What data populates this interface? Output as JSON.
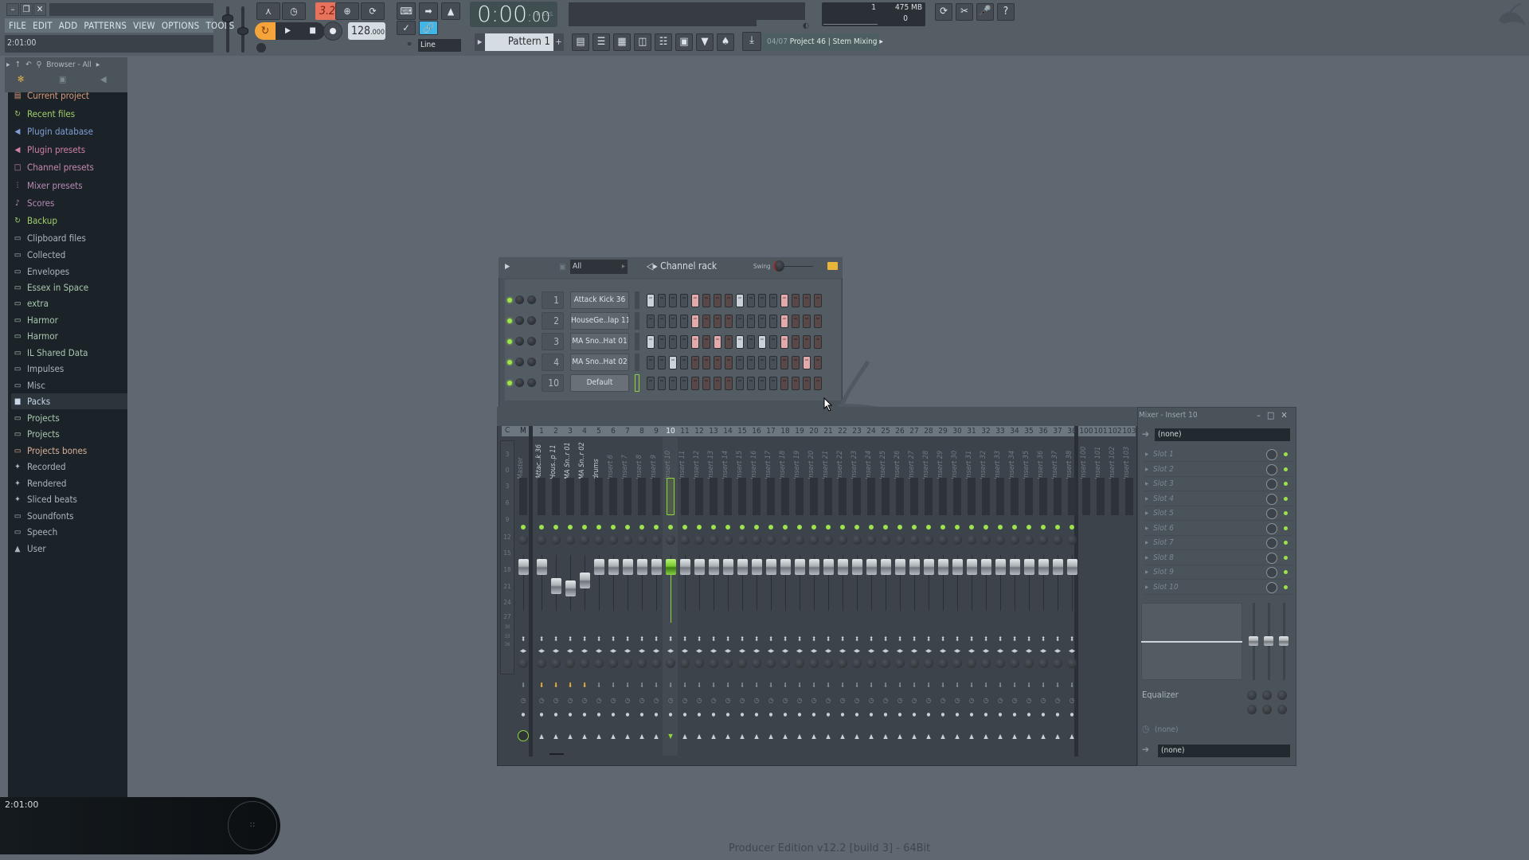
{
  "window": {
    "title": "",
    "controls": [
      "minimize",
      "restore",
      "close"
    ]
  },
  "menu": [
    "FILE",
    "EDIT",
    "ADD",
    "PATTERNS",
    "VIEW",
    "OPTIONS",
    "TOOLS",
    "?"
  ],
  "hint_bar": {
    "text": "2:01:00"
  },
  "toolbar": {
    "pattern_mode_label": "3.2",
    "tempo": "128",
    "tempo_decimals": ".000",
    "time": "0:00",
    "time_cs": ":00",
    "time_format": "M:S:CS",
    "snap_label": "Line",
    "pattern_name": "Pattern 1",
    "pattern_add": "+",
    "cpu_value": "1",
    "memory": "475 MB",
    "polyphony": "0",
    "song_info": {
      "index": "04/07",
      "name": "Project 46 | Stem Mixing"
    }
  },
  "browser": {
    "title": "Browser - All",
    "items": [
      {
        "label": "Current project",
        "icon": "project-icon",
        "color": "#d99a7a"
      },
      {
        "label": "Recent files",
        "icon": "recent-folder-icon",
        "color": "#9fcf6a"
      },
      {
        "label": "Plugin database",
        "icon": "plugin-icon",
        "color": "#7f9fd6"
      },
      {
        "label": "Plugin presets",
        "icon": "plugin-preset-icon",
        "color": "#d07fa6"
      },
      {
        "label": "Channel presets",
        "icon": "channel-icon",
        "color": "#c48ab0"
      },
      {
        "label": "Mixer presets",
        "icon": "mixer-icon",
        "color": "#b88ab8"
      },
      {
        "label": "Scores",
        "icon": "note-icon",
        "color": "#b88ab8"
      },
      {
        "label": "Backup",
        "icon": "recent-folder-icon",
        "color": "#9fcf6a"
      },
      {
        "label": "Clipboard files",
        "icon": "folder-icon",
        "color": "#a9b6bc"
      },
      {
        "label": "Collected",
        "icon": "folder-icon",
        "color": "#a9b6bc"
      },
      {
        "label": "Envelopes",
        "icon": "folder-icon",
        "color": "#a9b6bc"
      },
      {
        "label": "Essex in Space",
        "icon": "linked-folder-icon",
        "color": "#a9c8b0"
      },
      {
        "label": "extra",
        "icon": "linked-folder-icon",
        "color": "#a9c8b0"
      },
      {
        "label": "Harmor",
        "icon": "linked-folder-icon",
        "color": "#a9c8b0"
      },
      {
        "label": "Harmor",
        "icon": "linked-folder-icon",
        "color": "#a9c8b0"
      },
      {
        "label": "IL Shared Data",
        "icon": "linked-folder-icon",
        "color": "#a9c8b0"
      },
      {
        "label": "Impulses",
        "icon": "folder-icon",
        "color": "#a9b6bc"
      },
      {
        "label": "Misc",
        "icon": "folder-icon",
        "color": "#a9b6bc"
      },
      {
        "label": "Packs",
        "icon": "packs-icon",
        "color": "#c8d8e8",
        "selected": true
      },
      {
        "label": "Projects",
        "icon": "linked-folder-icon",
        "color": "#a9c8b0"
      },
      {
        "label": "Projects",
        "icon": "linked-folder-icon",
        "color": "#a9c8b0"
      },
      {
        "label": "Projects bones",
        "icon": "folder-icon",
        "color": "#d9b09a"
      },
      {
        "label": "Recorded",
        "icon": "wave-icon",
        "color": "#a9b6bc"
      },
      {
        "label": "Rendered",
        "icon": "wave-icon",
        "color": "#a9b6bc"
      },
      {
        "label": "Sliced beats",
        "icon": "wave-icon",
        "color": "#a9b6bc"
      },
      {
        "label": "Soundfonts",
        "icon": "folder-icon",
        "color": "#a9b6bc"
      },
      {
        "label": "Speech",
        "icon": "folder-icon",
        "color": "#a9b6bc"
      },
      {
        "label": "User",
        "icon": "user-icon",
        "color": "#a9b6bc"
      }
    ]
  },
  "channel_rack": {
    "title": "Channel rack",
    "filter": "All",
    "swing_label": "Swing",
    "channels": [
      {
        "num": "1",
        "name": "Attack Kick 36",
        "steps": [
          1,
          0,
          0,
          0,
          1,
          0,
          0,
          0,
          1,
          0,
          0,
          0,
          1,
          0,
          0,
          0
        ]
      },
      {
        "num": "2",
        "name": "HouseGe..lap 11",
        "steps": [
          0,
          0,
          0,
          0,
          1,
          0,
          0,
          0,
          0,
          0,
          0,
          0,
          1,
          0,
          0,
          0
        ]
      },
      {
        "num": "3",
        "name": "MA Sno..Hat 01",
        "steps": [
          1,
          0,
          0,
          0,
          1,
          0,
          1,
          0,
          1,
          0,
          1,
          0,
          1,
          0,
          0,
          0
        ]
      },
      {
        "num": "4",
        "name": "MA Sno..Hat 02",
        "steps": [
          0,
          0,
          1,
          0,
          0,
          0,
          0,
          0,
          0,
          0,
          0,
          0,
          0,
          0,
          1,
          0
        ]
      },
      {
        "num": "10",
        "name": "Default",
        "steps": [
          0,
          0,
          0,
          0,
          0,
          0,
          0,
          0,
          0,
          0,
          0,
          0,
          0,
          0,
          0,
          0
        ]
      }
    ],
    "add_label": "+"
  },
  "mixer": {
    "title": "Mixer - Insert 10",
    "selected_track": "10",
    "header_left": [
      "C",
      "M"
    ],
    "db_scale": [
      "3",
      "0",
      "3",
      "6",
      "9",
      "12",
      "15",
      "18",
      "21",
      "24",
      "27",
      "30",
      "33",
      "36"
    ],
    "tracks": [
      {
        "num": "M",
        "name": "Master",
        "fader": 0.78
      },
      {
        "num": "1",
        "name": "Attac..k 36",
        "fader": 0.78,
        "used": true,
        "routed": true
      },
      {
        "num": "2",
        "name": "Hous..p 11",
        "fader": 0.58,
        "used": true,
        "routed": true
      },
      {
        "num": "3",
        "name": "MA Sn..r 01",
        "fader": 0.56,
        "used": true,
        "routed": true
      },
      {
        "num": "4",
        "name": "MA Sn..r 02",
        "fader": 0.64,
        "used": true,
        "routed": true
      },
      {
        "num": "5",
        "name": "drums",
        "fader": 0.78,
        "used": true
      },
      {
        "num": "6",
        "name": "Insert 6",
        "fader": 0.78
      },
      {
        "num": "7",
        "name": "Insert 7",
        "fader": 0.78
      },
      {
        "num": "8",
        "name": "Insert 8",
        "fader": 0.78
      },
      {
        "num": "9",
        "name": "Insert 9",
        "fader": 0.78
      },
      {
        "num": "10",
        "name": "Insert 10",
        "fader": 0.78,
        "selected": true
      },
      {
        "num": "11",
        "name": "Insert 11",
        "fader": 0.78
      },
      {
        "num": "12",
        "name": "Insert 12",
        "fader": 0.78
      },
      {
        "num": "13",
        "name": "Insert 13",
        "fader": 0.78
      },
      {
        "num": "14",
        "name": "Insert 14",
        "fader": 0.78
      },
      {
        "num": "15",
        "name": "Insert 15",
        "fader": 0.78
      },
      {
        "num": "16",
        "name": "Insert 16",
        "fader": 0.78
      },
      {
        "num": "17",
        "name": "Insert 17",
        "fader": 0.78
      },
      {
        "num": "18",
        "name": "Insert 18",
        "fader": 0.78
      },
      {
        "num": "19",
        "name": "Insert 19",
        "fader": 0.78
      },
      {
        "num": "20",
        "name": "Insert 20",
        "fader": 0.78
      },
      {
        "num": "21",
        "name": "Insert 21",
        "fader": 0.78
      },
      {
        "num": "22",
        "name": "Insert 22",
        "fader": 0.78
      },
      {
        "num": "23",
        "name": "Insert 23",
        "fader": 0.78
      },
      {
        "num": "24",
        "name": "Insert 24",
        "fader": 0.78
      },
      {
        "num": "25",
        "name": "Insert 25",
        "fader": 0.78
      },
      {
        "num": "26",
        "name": "Insert 26",
        "fader": 0.78
      },
      {
        "num": "27",
        "name": "Insert 27",
        "fader": 0.78
      },
      {
        "num": "28",
        "name": "Insert 28",
        "fader": 0.78
      },
      {
        "num": "29",
        "name": "Insert 29",
        "fader": 0.78
      },
      {
        "num": "30",
        "name": "Insert 30",
        "fader": 0.78
      },
      {
        "num": "31",
        "name": "Insert 31",
        "fader": 0.78
      },
      {
        "num": "32",
        "name": "Insert 32",
        "fader": 0.78
      },
      {
        "num": "33",
        "name": "Insert 33",
        "fader": 0.78
      },
      {
        "num": "34",
        "name": "Insert 34",
        "fader": 0.78
      },
      {
        "num": "35",
        "name": "Insert 35",
        "fader": 0.78
      },
      {
        "num": "36",
        "name": "Insert 36",
        "fader": 0.78
      },
      {
        "num": "37",
        "name": "Insert 37",
        "fader": 0.78
      },
      {
        "num": "38",
        "name": "Insert 38",
        "fader": 0.78
      }
    ],
    "extra_tracks": [
      {
        "num": "100",
        "name": "Insert 100"
      },
      {
        "num": "101",
        "name": "Insert 101"
      },
      {
        "num": "102",
        "name": "Insert 102"
      },
      {
        "num": "103",
        "name": "Insert 103"
      }
    ],
    "insert": {
      "input": "(none)",
      "slots": [
        "Slot 1",
        "Slot 2",
        "Slot 3",
        "Slot 4",
        "Slot 5",
        "Slot 6",
        "Slot 7",
        "Slot 8",
        "Slot 9",
        "Slot 10"
      ],
      "eq_label": "Equalizer",
      "delay_comp": "(none)",
      "output": "(none)"
    }
  },
  "bottom_hint": {
    "time": "2:01:00"
  },
  "footer": "Producer Edition v12.2 [build 3] - 64Bit",
  "colors": {
    "accent_green": "#9de34a",
    "pattern_mode": "#e8735d",
    "loop_orange": "#f5a33b",
    "step_on_light": "#c9d3d8",
    "step_on_pink": "#e4a9aa",
    "step_off_grey": "#484f56",
    "step_off_brown": "#5a4748"
  }
}
